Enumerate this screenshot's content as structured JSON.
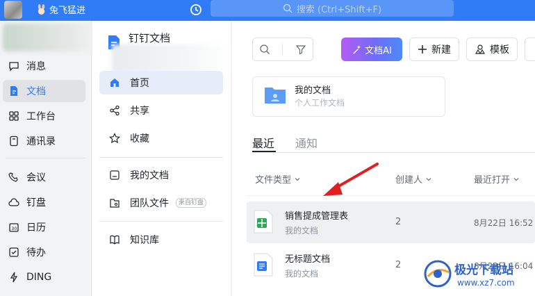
{
  "topbar": {
    "username": "兔飞猛进",
    "search_placeholder": "搜索 (Ctrl+Shift+F)"
  },
  "leftnav": {
    "items": [
      {
        "label": "消息",
        "icon": "message-icon"
      },
      {
        "label": "文档",
        "icon": "doc-icon"
      },
      {
        "label": "工作台",
        "icon": "workbench-icon"
      },
      {
        "label": "通讯录",
        "icon": "contacts-icon"
      },
      {
        "label": "会议",
        "icon": "meeting-icon"
      },
      {
        "label": "钉盘",
        "icon": "cloud-drive-icon"
      },
      {
        "label": "日历",
        "icon": "calendar-icon"
      },
      {
        "label": "待办",
        "icon": "todo-icon"
      },
      {
        "label": "DING",
        "icon": "ding-icon"
      }
    ],
    "active": "文档"
  },
  "docpanel": {
    "title": "钉钉文档",
    "items": [
      {
        "label": "首页",
        "icon": "home-icon"
      },
      {
        "label": "共享",
        "icon": "share-icon"
      },
      {
        "label": "收藏",
        "icon": "star-icon"
      },
      {
        "label": "我的文档",
        "icon": "my-doc-icon"
      },
      {
        "label": "团队文件",
        "icon": "team-file-icon",
        "badge": "来自钉盘"
      },
      {
        "label": "知识库",
        "icon": "book-icon"
      }
    ]
  },
  "toolbar": {
    "ai_label": "文档AI",
    "new_label": "新建",
    "template_label": "模板"
  },
  "mydoc_card": {
    "title": "我的文档",
    "subtitle": "个人工作文档"
  },
  "tabs": {
    "recent": "最近",
    "notice": "通知"
  },
  "table": {
    "headers": [
      "文件类型",
      "创建人",
      "最近打开"
    ],
    "rows": [
      {
        "name": "销售提成管理表",
        "location": "我的文档",
        "creator": "2",
        "opened": "8月22日 16:52",
        "type": "sheet"
      },
      {
        "name": "无标题文档",
        "location": "我的文档",
        "creator": "2",
        "opened": "8月22日 16:04",
        "type": "doc"
      }
    ]
  },
  "colors": {
    "accent": "#2f7cf6",
    "arrow": "#e02020",
    "sheet": "#2ea858"
  },
  "watermark": {
    "title": "极光下载站",
    "url": "www.xz7.com"
  }
}
